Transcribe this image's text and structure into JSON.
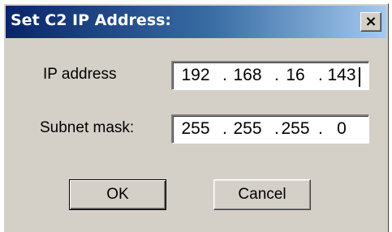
{
  "window": {
    "title": "Set C2 IP Address:",
    "close_glyph": "×"
  },
  "form": {
    "ip_label": "IP address",
    "ip_octets": [
      "192",
      "168",
      "16",
      "143"
    ],
    "mask_label": "Subnet mask:",
    "mask_octets": [
      "255",
      "255",
      "255",
      "0"
    ],
    "separator": "."
  },
  "buttons": {
    "ok_label": "OK",
    "cancel_label": "Cancel"
  },
  "icons": {
    "close": "close-icon"
  }
}
